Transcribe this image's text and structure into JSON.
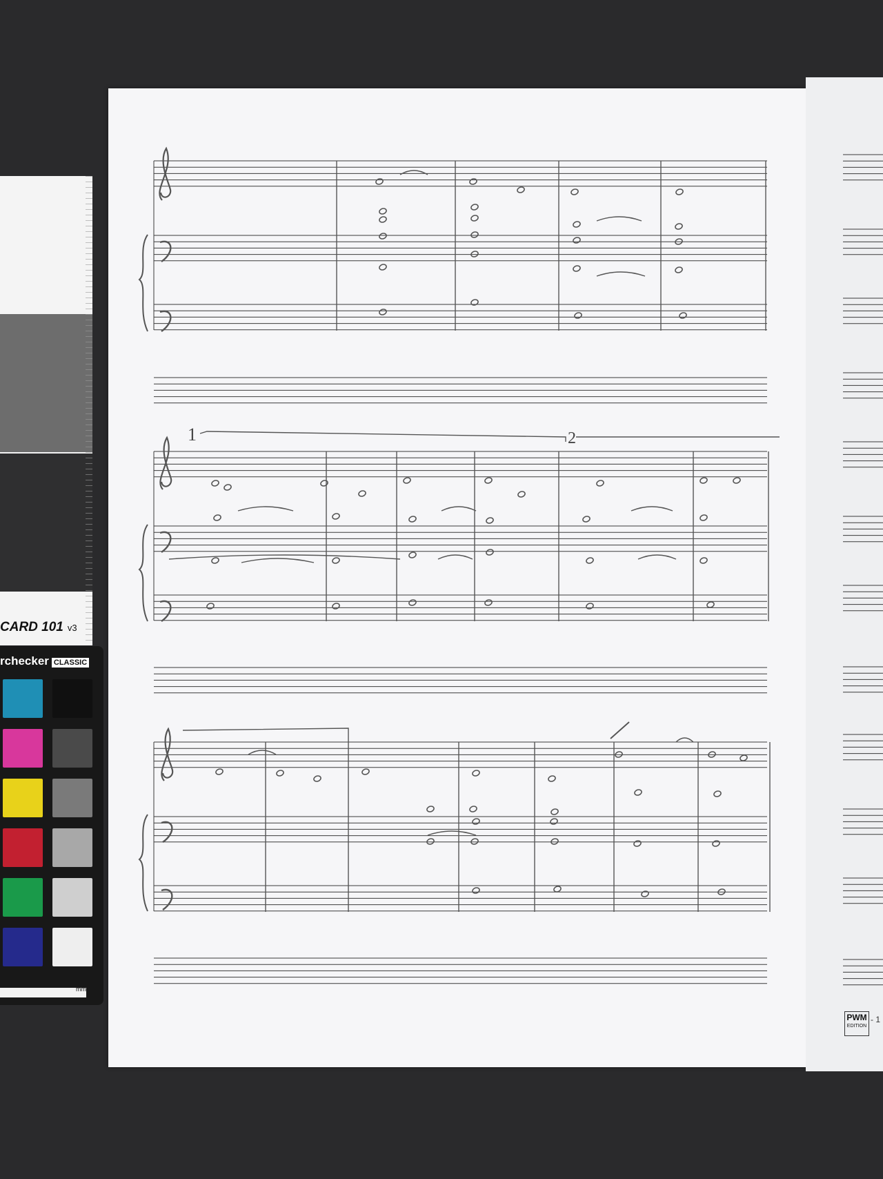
{
  "color_card": {
    "label": "CARD 101",
    "version": "v3"
  },
  "color_checker": {
    "title": "rchecker",
    "badge": "CLASSIC",
    "scale_unit": "mm",
    "swatches": [
      "#1f8fb5",
      "#101010",
      "#d8379c",
      "#4a4a4a",
      "#e8d21a",
      "#7a7a7a",
      "#c22030",
      "#a8a8a8",
      "#1a9a4a",
      "#cfcfcf",
      "#252a8c",
      "#eeeeee"
    ]
  },
  "score": {
    "volta_1": "1",
    "volta_2": "2"
  },
  "publisher": {
    "logo": "PWM",
    "logo_sub": "EDITION",
    "page_fragment": "- 1"
  }
}
